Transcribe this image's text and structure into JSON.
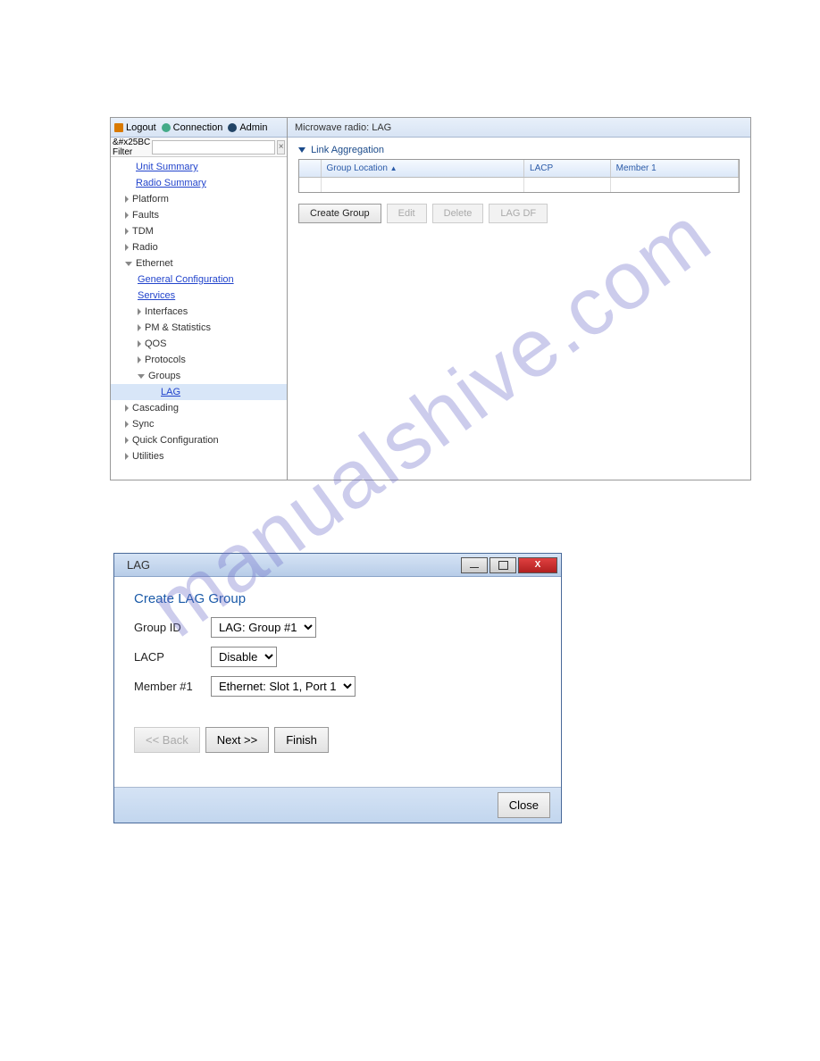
{
  "watermark": "manualshive.com",
  "app": {
    "topbar": {
      "logout": "Logout",
      "connection": "Connection",
      "admin": "Admin"
    },
    "filter": {
      "prefix": "&#x25BC Filter",
      "value": ""
    },
    "tree": {
      "unit_summary": "Unit Summary",
      "radio_summary": "Radio Summary",
      "platform": "Platform",
      "faults": "Faults",
      "tdm": "TDM",
      "radio": "Radio",
      "ethernet": "Ethernet",
      "general_config": "General Configuration",
      "services": "Services",
      "interfaces": "Interfaces",
      "pm_stats": "PM & Statistics",
      "qos": "QOS",
      "protocols": "Protocols",
      "groups": "Groups",
      "lag": "LAG",
      "cascading": "Cascading",
      "sync": "Sync",
      "quick_config": "Quick Configuration",
      "utilities": "Utilities"
    },
    "content": {
      "page_title": "Microwave radio: LAG",
      "section": "Link Aggregation",
      "columns": {
        "group_location": "Group Location",
        "lacp": "LACP",
        "member1": "Member 1"
      },
      "buttons": {
        "create": "Create Group",
        "edit": "Edit",
        "delete": "Delete",
        "lagdf": "LAG DF"
      }
    }
  },
  "dialog": {
    "title": "LAG",
    "header": "Create LAG Group",
    "labels": {
      "group_id": "Group ID",
      "lacp": "LACP",
      "member1": "Member #1"
    },
    "values": {
      "group_id": "LAG: Group #1",
      "lacp": "Disable",
      "member1": "Ethernet: Slot 1, Port 1"
    },
    "buttons": {
      "back": "<< Back",
      "next": "Next >>",
      "finish": "Finish",
      "close": "Close"
    }
  }
}
